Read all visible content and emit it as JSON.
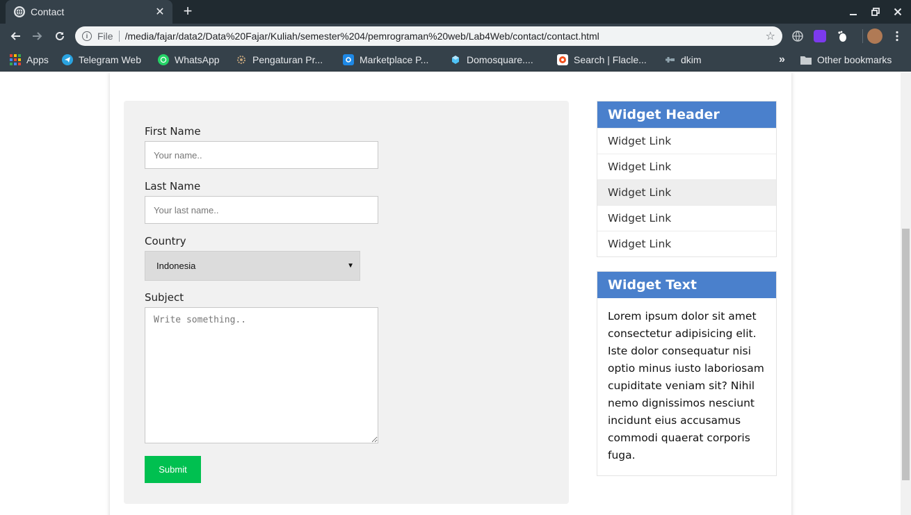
{
  "browser": {
    "tab": {
      "title": "Contact",
      "close_glyph": "✕",
      "favicon": "globe-icon"
    },
    "new_tab_glyph": "+",
    "address": {
      "scheme_label": "File",
      "url": "/media/fajar/data2/Data%20Fajar/Kuliah/semester%204/pemrograman%20web/Lab4Web/contact/contact.html",
      "info_glyph": "i",
      "star_glyph": "☆"
    },
    "bookmarks": [
      {
        "label": "Apps",
        "icon": "apps-grid-icon",
        "color": "#e94235"
      },
      {
        "label": "Telegram Web",
        "icon": "telegram-icon",
        "color": "#2aa3e0"
      },
      {
        "label": "WhatsApp",
        "icon": "whatsapp-icon",
        "color": "#25d366"
      },
      {
        "label": "Pengaturan Pr...",
        "icon": "settings-site-icon",
        "color": "#9e8a70"
      },
      {
        "label": "Marketplace P...",
        "icon": "marketplace-icon",
        "color": "#1e88e5"
      },
      {
        "label": "Domosquare....",
        "icon": "domosquare-icon",
        "color": "#4fc3f7"
      },
      {
        "label": "Search | Flacle...",
        "icon": "flaticon-icon",
        "color": "#f4511e"
      },
      {
        "label": "dkim",
        "icon": "dkim-icon",
        "color": "#90a4ae"
      }
    ],
    "bookmarks_overflow_glyph": "»",
    "other_bookmarks_label": "Other bookmarks"
  },
  "form": {
    "first_name": {
      "label": "First Name",
      "placeholder": "Your name.."
    },
    "last_name": {
      "label": "Last Name",
      "placeholder": "Your last name.."
    },
    "country": {
      "label": "Country",
      "selected": "Indonesia",
      "arrow_glyph": "▼"
    },
    "subject": {
      "label": "Subject",
      "placeholder": "Write something.."
    },
    "submit_label": "Submit"
  },
  "sidebar": {
    "links_widget": {
      "header": "Widget Header",
      "links": [
        "Widget Link",
        "Widget Link",
        "Widget Link",
        "Widget Link",
        "Widget Link"
      ]
    },
    "text_widget": {
      "header": "Widget Text",
      "body": "Lorem ipsum dolor sit amet consectetur adipisicing elit. Iste dolor consequatur nisi optio minus iusto laboriosam cupiditate veniam sit? Nihil nemo dignissimos nesciunt incidunt eius accusamus commodi quaerat corporis fuga."
    }
  },
  "colors": {
    "widget_header": "#4a80cc",
    "submit_button": "#00c050",
    "form_panel": "#f1f1f1",
    "chrome_dark": "#35414a"
  }
}
